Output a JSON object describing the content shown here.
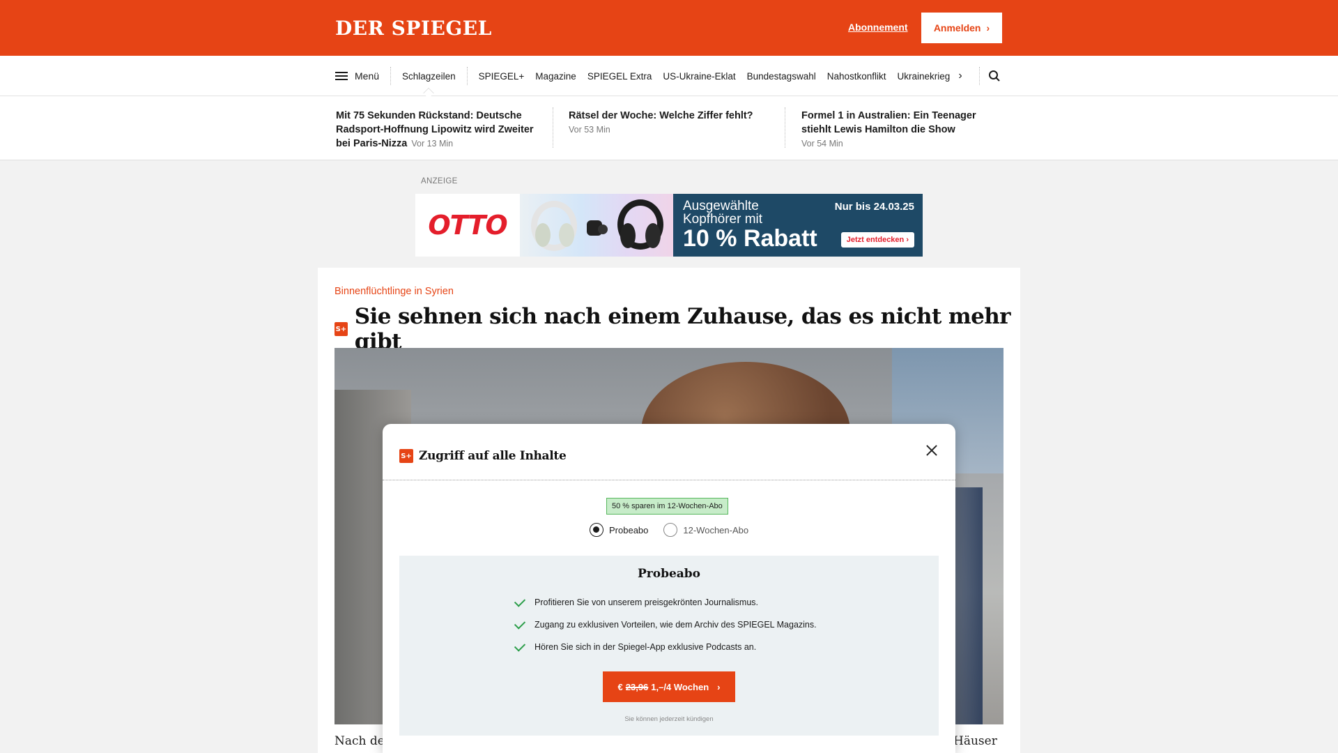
{
  "header": {
    "logo": "DER SPIEGEL",
    "abo_label": "Abonnement",
    "login_label": "Anmelden"
  },
  "nav": {
    "menu_label": "Menü",
    "links": [
      "Schlagzeilen",
      "SPIEGEL+",
      "Magazine",
      "SPIEGEL Extra",
      "US-Ukraine-Eklat",
      "Bundestagswahl",
      "Nahostkonflikt",
      "Ukrainekrieg"
    ]
  },
  "teasers": [
    {
      "title": "Mit 75 Sekunden Rückstand: Deutsche Radsport-Hoffnung Lipowitz wird Zweiter bei Paris-Nizza",
      "time": "Vor 13 Min"
    },
    {
      "title": "Rätsel der Woche: Welche Ziffer fehlt?",
      "time": "Vor 53 Min"
    },
    {
      "title": "Formel 1 in Australien: Ein Teenager stiehlt Lewis Hamilton die Show",
      "time": "Vor 54 Min"
    }
  ],
  "ad": {
    "label": "ANZEIGE",
    "brand": "OTTO",
    "line1": "Ausgewählte",
    "line2": "Kopfhörer mit",
    "discount": "10 % Rabatt",
    "date": "Nur bis 24.03.25",
    "button": "Jetzt entdecken"
  },
  "article": {
    "kicker": "Binnenflüchtlinge in Syrien",
    "splus_badge": "S+",
    "headline": "Sie sehnen sich nach einem Zuhause, das es nicht mehr gibt",
    "body_left": "Nach der",
    "body_right": "Häuser"
  },
  "modal": {
    "badge": "S+",
    "title": "Zugriff auf alle Inhalte",
    "savings": "50 % sparen im 12-Wochen-Abo",
    "options": [
      "Probeabo",
      "12-Wochen-Abo"
    ],
    "selected": "Probeabo",
    "plan": {
      "title": "Probeabo",
      "benefits": [
        "Profitieren Sie von unserem preisgekrönten Journalismus.",
        "Zugang zu exklusiven Vorteilen, wie dem Archiv des SPIEGEL Magazins.",
        "Hören Sie sich in der Spiegel-App exklusive Podcasts an."
      ],
      "cta_currency": "€",
      "cta_old_price": "23,96",
      "cta_new_price": "1,–/4 Wochen",
      "cancel_note": "Sie können jederzeit kündigen"
    }
  },
  "colors": {
    "brand": "#e64415",
    "otto_red": "#e41e2b",
    "ad_blue": "#1e4966",
    "savings_green": "#c7ecc9"
  }
}
